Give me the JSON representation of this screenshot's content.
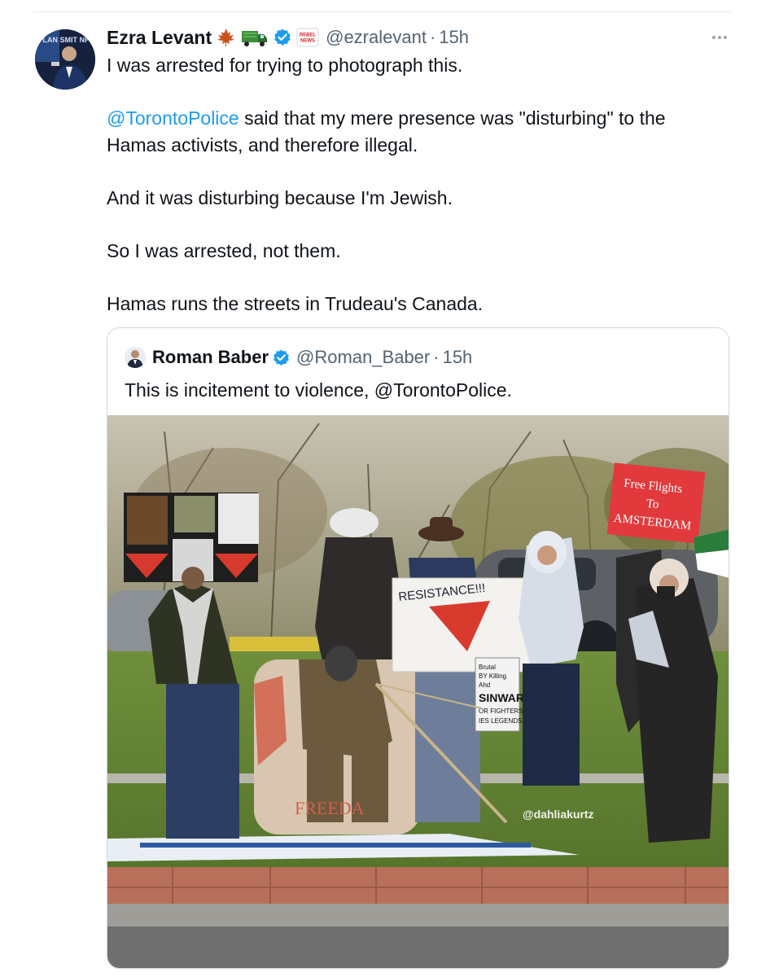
{
  "tweet": {
    "author": {
      "display_name": "Ezra Levant",
      "emojis": [
        "maple-leaf-icon",
        "truck-icon"
      ],
      "affiliate_badge_text": "REBEL NEWS",
      "handle": "@ezralevant",
      "separator": "·",
      "time": "15h"
    },
    "text": {
      "line1": "I was arrested for trying to photograph this.",
      "line2_mention": "@TorontoPolice",
      "line2_rest": " said that my mere presence was \"disturbing\" to the",
      "line3": "Hamas activists, and therefore illegal.",
      "line4": "And it was disturbing because I'm Jewish.",
      "line5": "So I was arrested, not them.",
      "line6": "Hamas runs the streets in Trudeau's Canada."
    },
    "avatar_overlay_text": "FLAN SMIT NF",
    "quote": {
      "display_name": "Roman Baber",
      "handle": "@Roman_Baber",
      "separator": "·",
      "time": "15h",
      "text": "This is incitement to violence, @TorontoPolice.",
      "media": {
        "sign_left_words": [
          "RESISTANCE!!!"
        ],
        "sign_right_lines": [
          "Free Flights",
          "To",
          "AMSTERDAM"
        ],
        "small_sign_lines": [
          "Brutal",
          "BY Killing",
          "Ahd",
          "SINWAR",
          "OR FIGHTERS",
          "IES LEGENDS"
        ],
        "chair_text": "FREEDA",
        "watermark": "@dahliakurtz"
      }
    }
  },
  "colors": {
    "link": "#1d9bf0",
    "verified": "#1d9bf0",
    "secondary_text": "#536471",
    "card_border": "#cfd9de"
  }
}
